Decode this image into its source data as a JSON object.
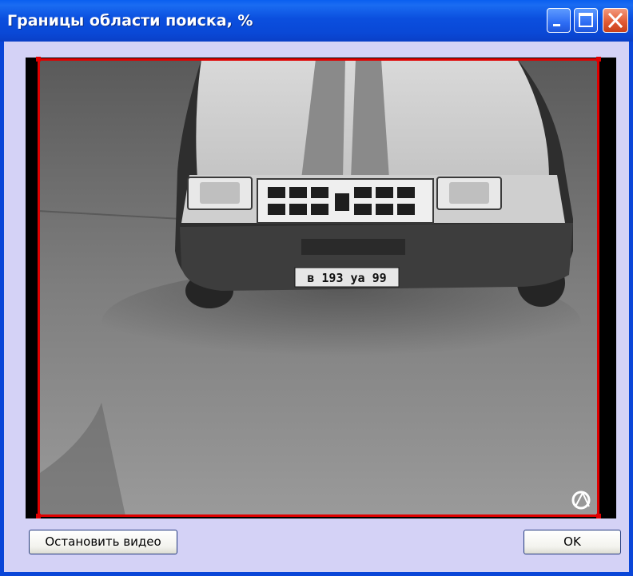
{
  "window": {
    "title": "Границы области поиска, %",
    "controls": {
      "minimize": "minimize",
      "maximize": "maximize",
      "close": "close"
    }
  },
  "video": {
    "license_plate": "в 193 уа 99"
  },
  "buttons": {
    "stop_video": "Остановить видео",
    "ok": "OK"
  },
  "colors": {
    "titlebar": "#0a4fde",
    "client_bg": "#d4d2f6",
    "roi_border": "#e00000",
    "close_button": "#e25c35"
  }
}
